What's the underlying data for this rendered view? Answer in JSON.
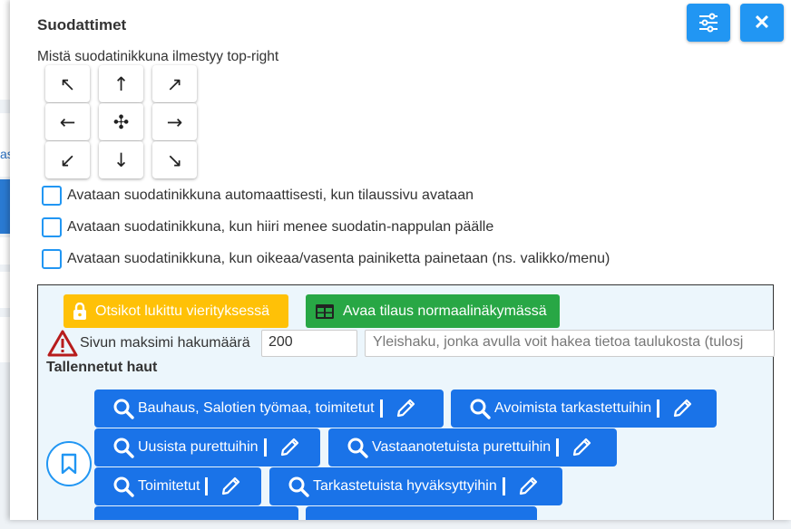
{
  "modal": {
    "title": "Suodattimet",
    "position_label": "Mistä suodatinikkuna ilmestyy top-right",
    "close_label": "✕",
    "checkboxes": [
      {
        "label": "Avataan suodatinikkuna automaattisesti, kun tilaussivu avataan",
        "checked": false
      },
      {
        "label": "Avataan suodatinikkuna, kun hiiri menee suodatin-nappulan päälle",
        "checked": false
      },
      {
        "label": "Avataan suodatinikkuna, kun oikeaa/vasenta painiketta painetaan (ns. valikko/menu)",
        "checked": false
      }
    ],
    "arrows": [
      "↖",
      "↑",
      "↗",
      "←",
      "✣",
      "→",
      "↙",
      "↓",
      "↘"
    ]
  },
  "panel": {
    "lock_button": "Otsikot lukittu vierityksessä",
    "open_button": "Avaa tilaus normaalinäkymässä",
    "max_label": "Sivun maksimi hakumäärä",
    "max_value": "200",
    "search_placeholder": "Yleishaku, jonka avulla voit hakea tietoa taulukosta (tulosj",
    "saved_title": "Tallennetut haut",
    "saved_searches": [
      "Bauhaus, Salotien työmaa, toimitetut",
      "Avoimista tarkastettuihin",
      "Uusista purettuihin",
      "Vastaanotetuista purettuihin",
      "Toimitetut",
      "Tarkastetuista hyväksyttyihin"
    ]
  },
  "colors": {
    "primary": "#2196f3",
    "saved_button": "#1a73e8",
    "warning": "#ffc107",
    "success": "#28a745",
    "danger": "#b71c1c",
    "panel_bg": "#ecf6fc"
  },
  "background": {
    "partial_text": "as"
  }
}
